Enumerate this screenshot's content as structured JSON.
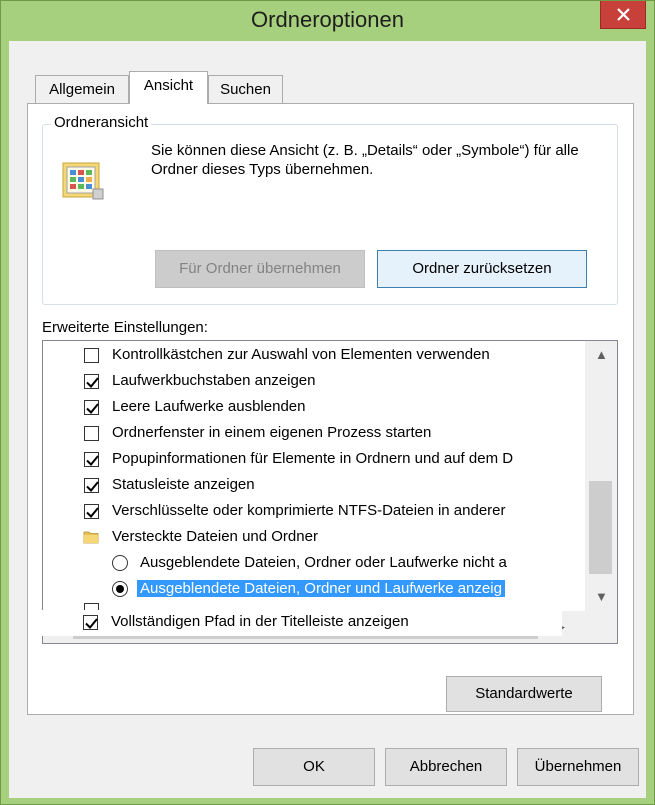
{
  "window": {
    "title": "Ordneroptionen"
  },
  "tabs": [
    {
      "label": "Allgemein",
      "active": false
    },
    {
      "label": "Ansicht",
      "active": true
    },
    {
      "label": "Suchen",
      "active": false
    }
  ],
  "folder_view": {
    "group_label": "Ordneransicht",
    "description": "Sie können diese Ansicht (z. B. „Details“ oder „Symbole“) für alle Ordner dieses Typs übernehmen.",
    "apply_button": "Für Ordner übernehmen",
    "reset_button": "Ordner zurücksetzen"
  },
  "advanced": {
    "label": "Erweiterte Einstellungen:",
    "items": [
      {
        "type": "checkbox",
        "checked": false,
        "label": "Kontrollkästchen zur Auswahl von Elementen verwenden"
      },
      {
        "type": "checkbox",
        "checked": true,
        "label": "Laufwerkbuchstaben anzeigen"
      },
      {
        "type": "checkbox",
        "checked": true,
        "label": "Leere Laufwerke ausblenden"
      },
      {
        "type": "checkbox",
        "checked": false,
        "label": "Ordnerfenster in einem eigenen Prozess starten"
      },
      {
        "type": "checkbox",
        "checked": true,
        "label": "Popupinformationen für Elemente in Ordnern und auf dem D"
      },
      {
        "type": "checkbox",
        "checked": true,
        "label": "Statusleiste anzeigen"
      },
      {
        "type": "checkbox",
        "checked": true,
        "label": "Verschlüsselte oder komprimierte NTFS-Dateien in anderer"
      },
      {
        "type": "folder",
        "label": "Versteckte Dateien und Ordner"
      },
      {
        "type": "radio",
        "checked": false,
        "label": "Ausgeblendete Dateien, Ordner oder Laufwerke nicht a"
      },
      {
        "type": "radio",
        "checked": true,
        "selected": true,
        "label": "Ausgeblendete Dateien, Ordner und Laufwerke anzeig"
      },
      {
        "type": "checkbox",
        "checked": true,
        "label": "Vollständigen Pfad in der Titelleiste anzeigen"
      }
    ],
    "defaults_button": "Standardwerte"
  },
  "footer": {
    "ok": "OK",
    "cancel": "Abbrechen",
    "apply": "Übernehmen"
  },
  "colors": {
    "titlebar": "#a7d07e",
    "close": "#c7413a",
    "selection": "#3399ff"
  }
}
